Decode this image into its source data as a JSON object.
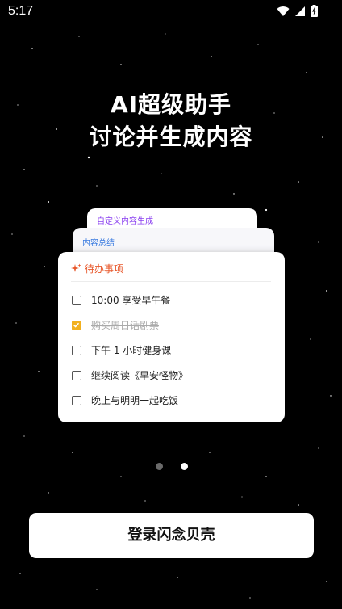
{
  "status_bar": {
    "time": "5:17",
    "icons": [
      "wifi-icon",
      "signal-icon",
      "battery-charging-icon"
    ]
  },
  "hero": {
    "line1": "AI超级助手",
    "line2": "讨论并生成内容"
  },
  "cards": {
    "back1_title": "自定义内容生成",
    "back2_title": "内容总结",
    "main_title": "待办事项",
    "todos": [
      {
        "text": "10:00 享受早午餐",
        "checked": false
      },
      {
        "text": "购买周日话剧票",
        "checked": true
      },
      {
        "text": "下午 1 小时健身课",
        "checked": false
      },
      {
        "text": "继续阅读《早安怪物》",
        "checked": false
      },
      {
        "text": "晚上与明明一起吃饭",
        "checked": false
      }
    ]
  },
  "pager": {
    "count": 2,
    "active_index": 1
  },
  "login_button": {
    "label": "登录闪念贝壳"
  },
  "colors": {
    "accent_orange": "#e8582b",
    "check_yellow": "#f2b01e",
    "purple": "#8a3ff0",
    "blue": "#3a7be0"
  }
}
